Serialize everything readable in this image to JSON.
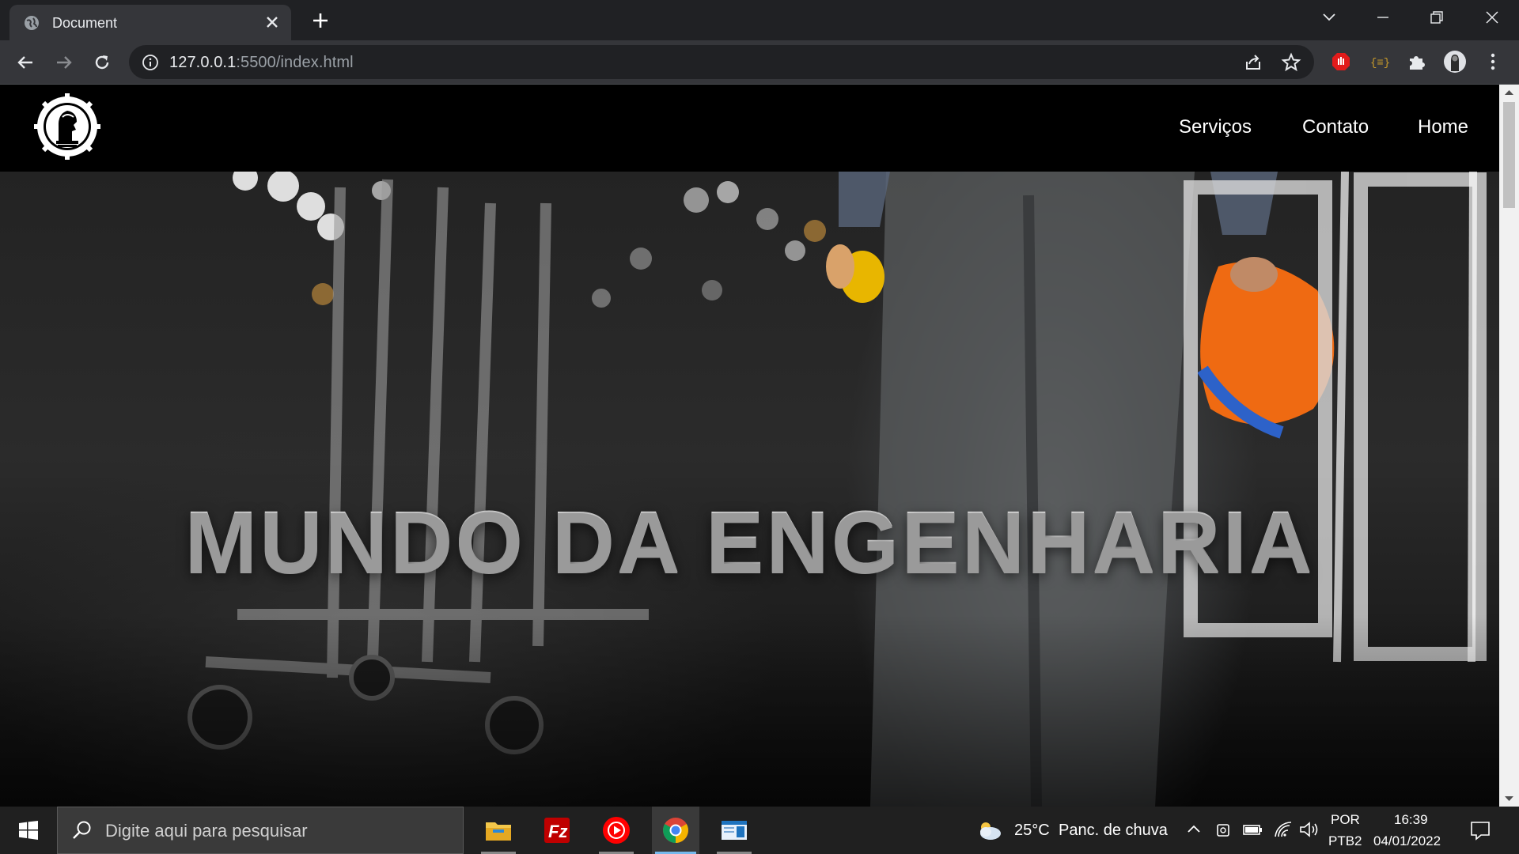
{
  "browser": {
    "tab_title": "Document",
    "url_host": "127.0.0.1",
    "url_rest": ":5500/index.html"
  },
  "site": {
    "nav": [
      "Serviços",
      "Contato",
      "Home"
    ],
    "hero_title": "MUNDO DA ENGENHARIA"
  },
  "taskbar": {
    "search_placeholder": "Digite aqui para pesquisar",
    "weather_temp": "25°C",
    "weather_desc": "Panc. de chuva",
    "lang_top": "POR",
    "lang_bottom": "PTB2",
    "time": "16:39",
    "date": "04/01/2022"
  },
  "colors": {
    "tab_bar": "#202124",
    "toolbar": "#35363a",
    "taskbar": "#202020",
    "accent": "#76b9ed"
  }
}
